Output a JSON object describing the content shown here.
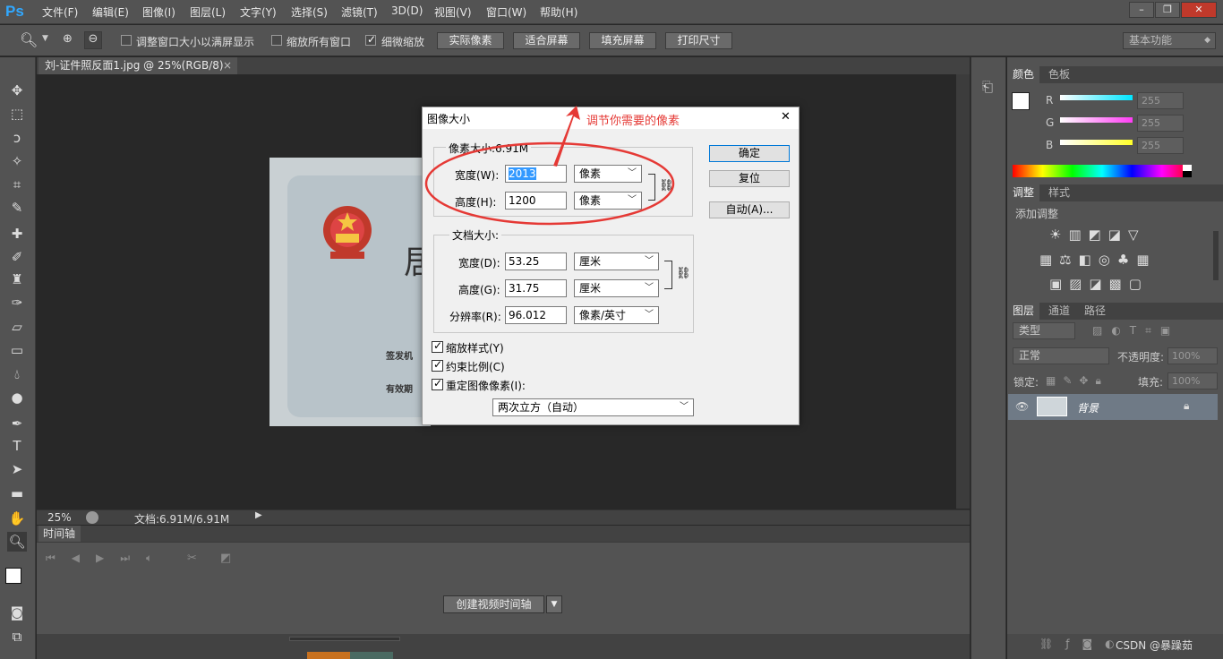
{
  "app": {
    "logo": "Ps"
  },
  "menu": [
    "文件(F)",
    "编辑(E)",
    "图像(I)",
    "图层(L)",
    "文字(Y)",
    "选择(S)",
    "滤镜(T)",
    "3D(D)",
    "视图(V)",
    "窗口(W)",
    "帮助(H)"
  ],
  "window_controls": {
    "minimize": "–",
    "restore": "❐",
    "close": "✕"
  },
  "options": {
    "resize_window": "调整窗口大小以满屏显示",
    "zoom_all": "缩放所有窗口",
    "scrubby_zoom": "细微缩放",
    "buttons": [
      "实际像素",
      "适合屏幕",
      "填充屏幕",
      "打印尺寸"
    ],
    "workspace": "基本功能"
  },
  "document": {
    "tab_title": "刘-证件照反面1.jpg @ 25%(RGB/8)",
    "tab_close": "×"
  },
  "photo_text": {
    "line1": "签发机",
    "line2": "有效期",
    "big_char": "居"
  },
  "status": {
    "zoom": "25%",
    "doc": "文档:6.91M/6.91M"
  },
  "timeline": {
    "tab": "时间轴",
    "create_button": "创建视频时间轴"
  },
  "color_panel": {
    "tabs": [
      "颜色",
      "色板"
    ],
    "channels": [
      {
        "label": "R",
        "value": "255",
        "color": "#00e5ff"
      },
      {
        "label": "G",
        "value": "255",
        "color": "#ff3df5"
      },
      {
        "label": "B",
        "value": "255",
        "color": "#ffff2a"
      }
    ]
  },
  "adjust_panel": {
    "tabs": [
      "调整",
      "样式"
    ],
    "title": "添加调整"
  },
  "layers_panel": {
    "tabs": [
      "图层",
      "通道",
      "路径"
    ],
    "filter": "类型",
    "blend_mode": "正常",
    "opacity_label": "不透明度:",
    "opacity_value": "100%",
    "lock_label": "锁定:",
    "fill_label": "填充:",
    "fill_value": "100%",
    "layer_name": "背景"
  },
  "watermark": "CSDN @暴躁茹",
  "dialog": {
    "title": "图像大小",
    "close": "✕",
    "pixel_section": "像素大小:6.91M",
    "width_label": "宽度(W):",
    "width_value": "2013",
    "width_unit": "像素",
    "height_label": "高度(H):",
    "height_value": "1200",
    "height_unit": "像素",
    "doc_section": "文档大小:",
    "doc_width_label": "宽度(D):",
    "doc_width_value": "53.25",
    "doc_width_unit": "厘米",
    "doc_height_label": "高度(G):",
    "doc_height_value": "31.75",
    "doc_height_unit": "厘米",
    "resolution_label": "分辨率(R):",
    "resolution_value": "96.012",
    "resolution_unit": "像素/英寸",
    "scale_styles": "缩放样式(Y)",
    "constrain": "约束比例(C)",
    "resample": "重定图像像素(I):",
    "resample_method": "两次立方（自动）",
    "ok": "确定",
    "reset": "复位",
    "auto": "自动(A)..."
  },
  "annotation": {
    "text": "调节你需要的像素",
    "color": "#e53935"
  }
}
